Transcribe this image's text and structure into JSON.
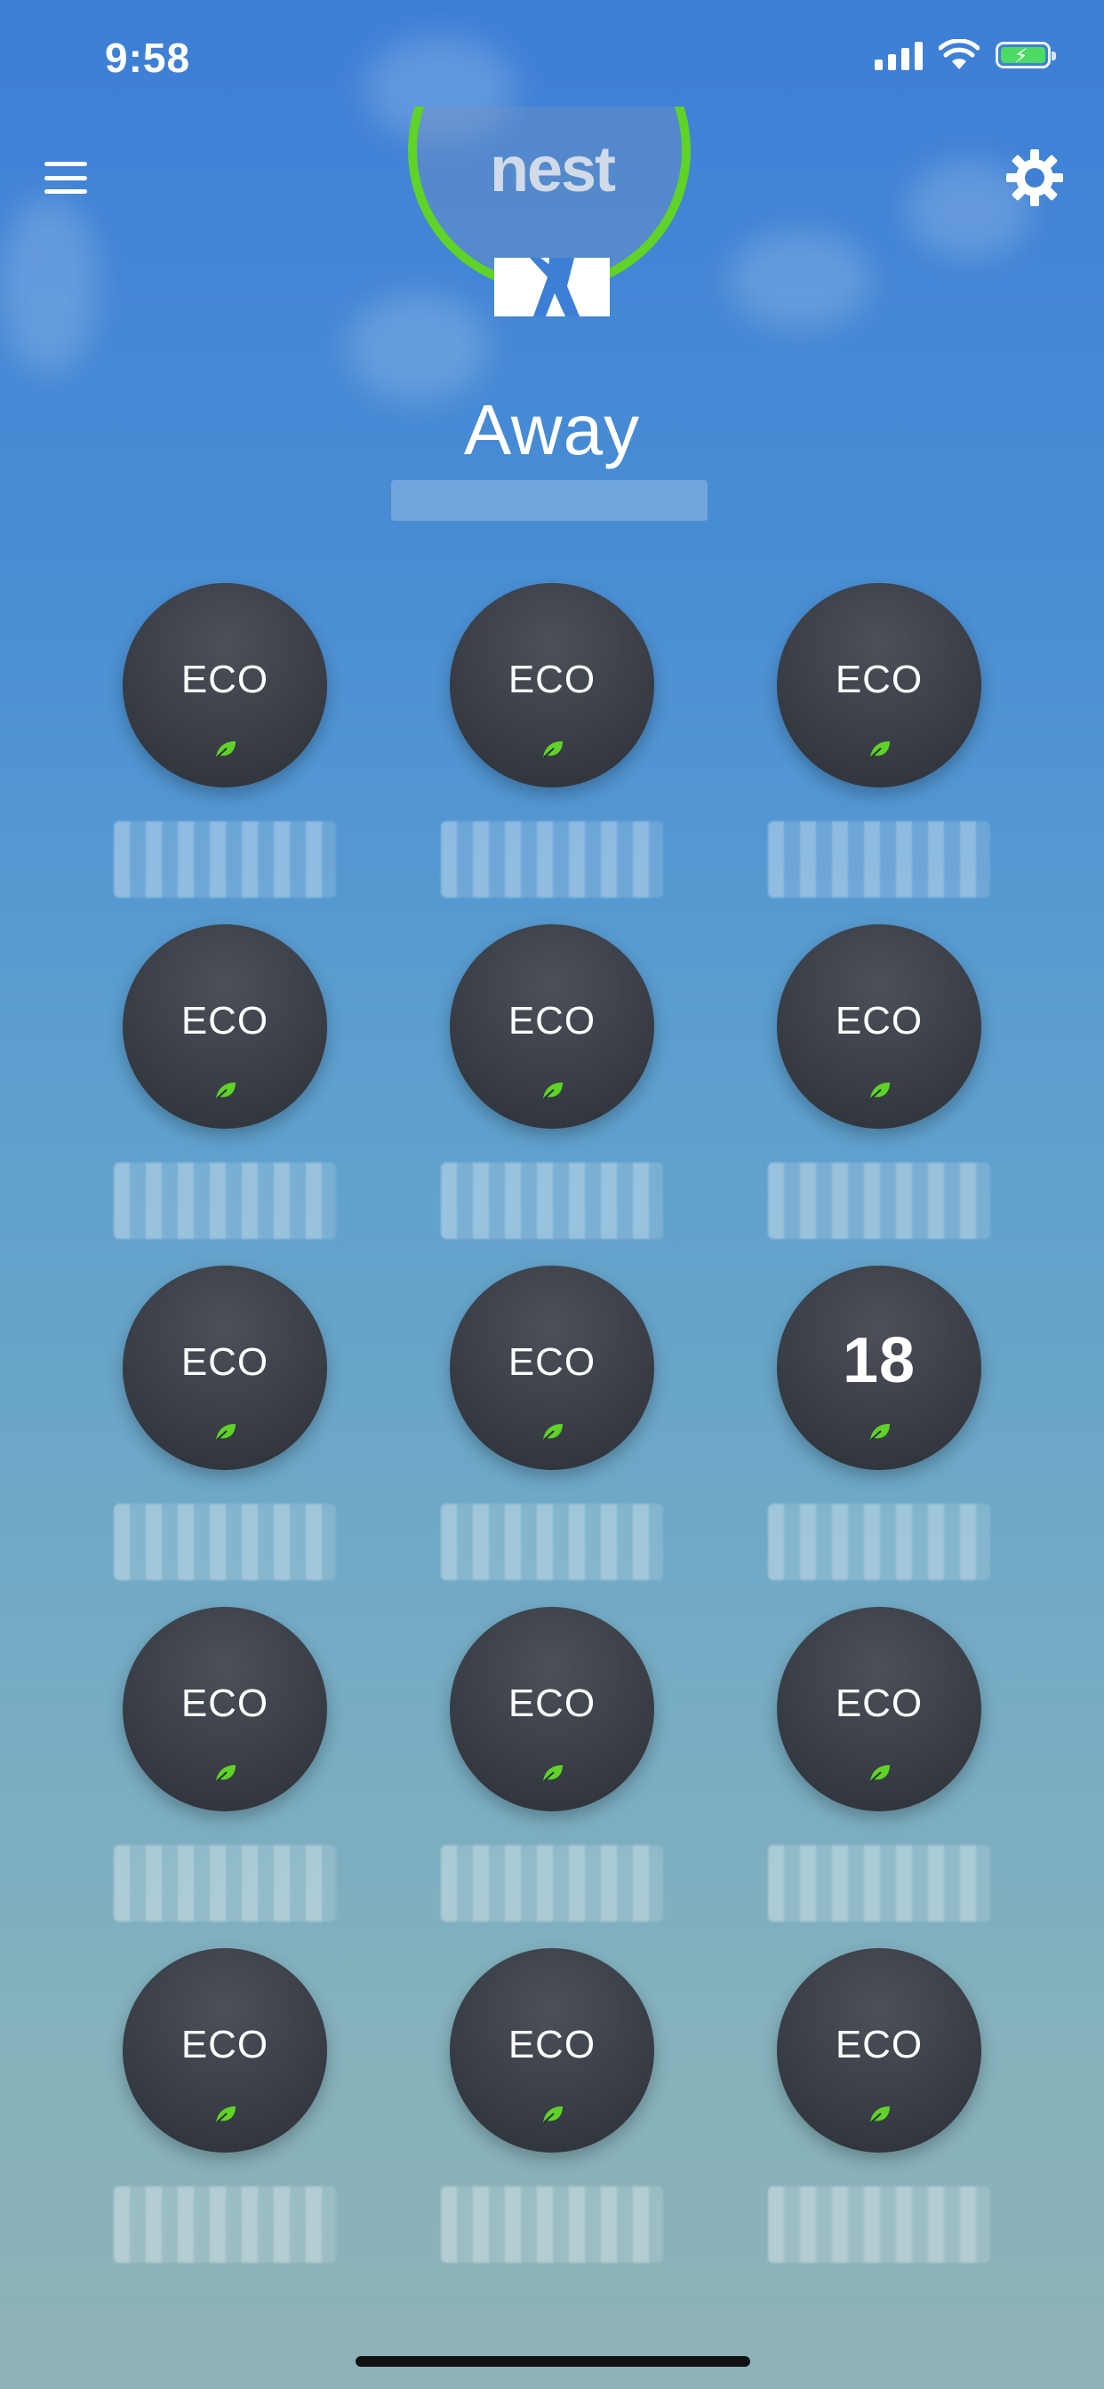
{
  "status_bar": {
    "time": "9:58"
  },
  "header": {
    "logo": "nest",
    "menu_icon": "hamburger-menu-icon",
    "settings_icon": "gear-icon"
  },
  "mode": {
    "label": "Away",
    "ring_color": "#5fd327"
  },
  "thermostats": [
    {
      "value": "ECO"
    },
    {
      "value": "ECO"
    },
    {
      "value": "ECO"
    },
    {
      "value": "ECO"
    },
    {
      "value": "ECO"
    },
    {
      "value": "ECO"
    },
    {
      "value": "ECO"
    },
    {
      "value": "ECO"
    },
    {
      "value": "18"
    },
    {
      "value": "ECO"
    },
    {
      "value": "ECO"
    },
    {
      "value": "ECO"
    },
    {
      "value": "ECO"
    },
    {
      "value": "ECO"
    },
    {
      "value": "ECO"
    }
  ],
  "colors": {
    "leaf": "#5fd327",
    "tile": "#3a3e46"
  }
}
